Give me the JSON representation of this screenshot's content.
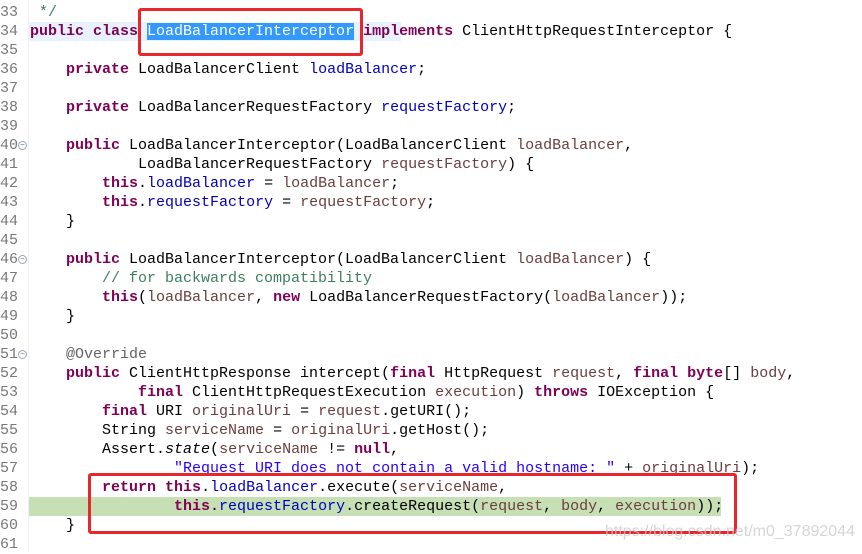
{
  "editor": {
    "highlight_colors": {
      "selection": "#3399ff",
      "current_line": "#e8f2fe",
      "debug_line": "#c7dfb5",
      "annotation_box": "#e8262b"
    },
    "lines": [
      {
        "num": "33",
        "tokens": [
          [
            " */",
            "comment"
          ]
        ]
      },
      {
        "num": "34",
        "hl": "current",
        "tokens": [
          [
            "public class ",
            "kw"
          ],
          [
            "LoadBalancerInterceptor",
            "sel"
          ],
          [
            " ",
            ""
          ],
          [
            "implements",
            "kw"
          ],
          [
            " ClientHttpRequestInterceptor {",
            ""
          ]
        ]
      },
      {
        "num": "35",
        "tokens": []
      },
      {
        "num": "36",
        "tokens": [
          [
            "    private",
            "kw"
          ],
          [
            " LoadBalancerClient ",
            ""
          ],
          [
            "loadBalancer",
            "field"
          ],
          [
            ";",
            ""
          ]
        ]
      },
      {
        "num": "37",
        "tokens": []
      },
      {
        "num": "38",
        "tokens": [
          [
            "    private",
            "kw"
          ],
          [
            " LoadBalancerRequestFactory ",
            ""
          ],
          [
            "requestFactory",
            "field"
          ],
          [
            ";",
            ""
          ]
        ]
      },
      {
        "num": "39",
        "tokens": []
      },
      {
        "num": "40",
        "fold": true,
        "tokens": [
          [
            "    public",
            "kw"
          ],
          [
            " LoadBalancerInterceptor(LoadBalancerClient ",
            ""
          ],
          [
            "loadBalancer",
            "param"
          ],
          [
            ",",
            ""
          ]
        ]
      },
      {
        "num": "41",
        "tokens": [
          [
            "            LoadBalancerRequestFactory ",
            ""
          ],
          [
            "requestFactory",
            "param"
          ],
          [
            ") {",
            ""
          ]
        ]
      },
      {
        "num": "42",
        "tokens": [
          [
            "        this",
            "kw"
          ],
          [
            ".",
            ""
          ],
          [
            "loadBalancer",
            "field"
          ],
          [
            " = ",
            ""
          ],
          [
            "loadBalancer",
            "param"
          ],
          [
            ";",
            ""
          ]
        ]
      },
      {
        "num": "43",
        "tokens": [
          [
            "        this",
            "kw"
          ],
          [
            ".",
            ""
          ],
          [
            "requestFactory",
            "field"
          ],
          [
            " = ",
            ""
          ],
          [
            "requestFactory",
            "param"
          ],
          [
            ";",
            ""
          ]
        ]
      },
      {
        "num": "44",
        "tokens": [
          [
            "    }",
            ""
          ]
        ]
      },
      {
        "num": "45",
        "tokens": []
      },
      {
        "num": "46",
        "fold": true,
        "tokens": [
          [
            "    public",
            "kw"
          ],
          [
            " LoadBalancerInterceptor(LoadBalancerClient ",
            ""
          ],
          [
            "loadBalancer",
            "param"
          ],
          [
            ") {",
            ""
          ]
        ]
      },
      {
        "num": "47",
        "tokens": [
          [
            "        // for backwards compatibility",
            "comment"
          ]
        ]
      },
      {
        "num": "48",
        "tokens": [
          [
            "        this",
            "kw"
          ],
          [
            "(",
            ""
          ],
          [
            "loadBalancer",
            "param"
          ],
          [
            ", ",
            ""
          ],
          [
            "new",
            "kw"
          ],
          [
            " LoadBalancerRequestFactory(",
            ""
          ],
          [
            "loadBalancer",
            "param"
          ],
          [
            "));",
            ""
          ]
        ]
      },
      {
        "num": "49",
        "tokens": [
          [
            "    }",
            ""
          ]
        ]
      },
      {
        "num": "50",
        "tokens": []
      },
      {
        "num": "51",
        "fold": true,
        "tokens": [
          [
            "    @Override",
            "anno"
          ]
        ]
      },
      {
        "num": "52",
        "tokens": [
          [
            "    public",
            "kw"
          ],
          [
            " ClientHttpResponse intercept(",
            ""
          ],
          [
            "final",
            "kw"
          ],
          [
            " HttpRequest ",
            ""
          ],
          [
            "request",
            "param"
          ],
          [
            ", ",
            ""
          ],
          [
            "final",
            "kw"
          ],
          [
            " ",
            ""
          ],
          [
            "byte",
            "kw"
          ],
          [
            "[] ",
            ""
          ],
          [
            "body",
            "param"
          ],
          [
            ",",
            ""
          ]
        ]
      },
      {
        "num": "53",
        "tokens": [
          [
            "            final",
            "kw"
          ],
          [
            " ClientHttpRequestExecution ",
            ""
          ],
          [
            "execution",
            "param"
          ],
          [
            ") ",
            ""
          ],
          [
            "throws",
            "kw"
          ],
          [
            " IOException {",
            ""
          ]
        ]
      },
      {
        "num": "54",
        "tokens": [
          [
            "        final",
            "kw"
          ],
          [
            " URI ",
            ""
          ],
          [
            "originalUri",
            "param"
          ],
          [
            " = ",
            ""
          ],
          [
            "request",
            "param"
          ],
          [
            ".getURI();",
            ""
          ]
        ]
      },
      {
        "num": "55",
        "tokens": [
          [
            "        String ",
            ""
          ],
          [
            "serviceName",
            "param"
          ],
          [
            " = ",
            ""
          ],
          [
            "originalUri",
            "param"
          ],
          [
            ".getHost();",
            ""
          ]
        ]
      },
      {
        "num": "56",
        "tokens": [
          [
            "        Assert.",
            ""
          ],
          [
            "state",
            "italic"
          ],
          [
            "(",
            ""
          ],
          [
            "serviceName",
            "param"
          ],
          [
            " != ",
            ""
          ],
          [
            "null",
            "kw"
          ],
          [
            ",",
            ""
          ]
        ]
      },
      {
        "num": "57",
        "tokens": [
          [
            "                ",
            ""
          ],
          [
            "\"Request URI does not contain a valid hostname: \"",
            "string"
          ],
          [
            " + ",
            ""
          ],
          [
            "originalUri",
            "param"
          ],
          [
            ");",
            ""
          ]
        ]
      },
      {
        "num": "58",
        "tokens": [
          [
            "        return",
            "kw"
          ],
          [
            " ",
            ""
          ],
          [
            "this",
            "kw"
          ],
          [
            ".",
            ""
          ],
          [
            "loadBalancer",
            "field"
          ],
          [
            ".execute(",
            ""
          ],
          [
            "serviceName",
            "param"
          ],
          [
            ",",
            ""
          ]
        ]
      },
      {
        "num": "59",
        "hl": "green",
        "tokens": [
          [
            "                this",
            "kw"
          ],
          [
            ".",
            ""
          ],
          [
            "requestFactory",
            "field"
          ],
          [
            ".createRequest(",
            ""
          ],
          [
            "request",
            "param"
          ],
          [
            ", ",
            ""
          ],
          [
            "body",
            "param"
          ],
          [
            ", ",
            ""
          ],
          [
            "execution",
            "param"
          ],
          [
            "));",
            ""
          ]
        ]
      },
      {
        "num": "60",
        "tokens": [
          [
            "    }",
            ""
          ]
        ]
      },
      {
        "num": "61",
        "tokens": []
      }
    ]
  },
  "watermark": "https://blog.csdn.net/m0_37892044"
}
